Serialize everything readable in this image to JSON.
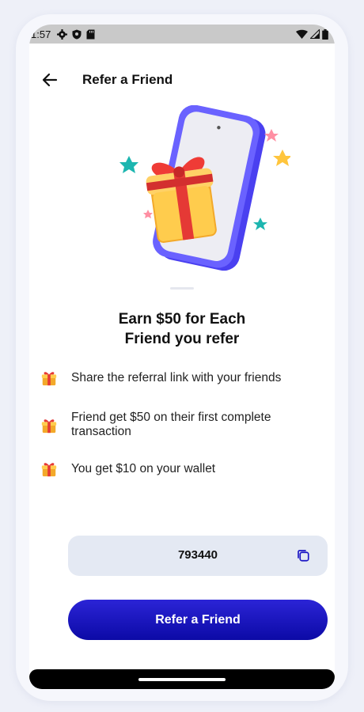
{
  "status_bar": {
    "time": "1:57",
    "left_icons": [
      "gear-icon",
      "shield-icon",
      "sd-card-icon"
    ],
    "right_icons": [
      "wifi-icon",
      "cell-signal-icon",
      "battery-icon"
    ]
  },
  "header": {
    "back_icon": "arrow-left-icon",
    "title": "Refer a Friend"
  },
  "hero": {
    "illustration": "phone-with-gift-illustration"
  },
  "headline": {
    "line1": "Earn $50 for Each",
    "line2": "Friend you refer"
  },
  "benefits": [
    {
      "icon": "gift-icon",
      "text": "Share the referral link with your friends"
    },
    {
      "icon": "gift-icon",
      "text": "Friend get $50 on their first complete transaction"
    },
    {
      "icon": "gift-icon",
      "text": "You get $10 on your wallet"
    }
  ],
  "referral": {
    "code": "793440",
    "copy_icon": "copy-icon"
  },
  "cta": {
    "label": "Refer a Friend"
  },
  "colors": {
    "primary": "#1a14c4",
    "code_bg": "#e4e9f3",
    "gift_red": "#e53935",
    "gift_yellow": "#ffc94d",
    "phone_purple": "#5b52ff"
  }
}
